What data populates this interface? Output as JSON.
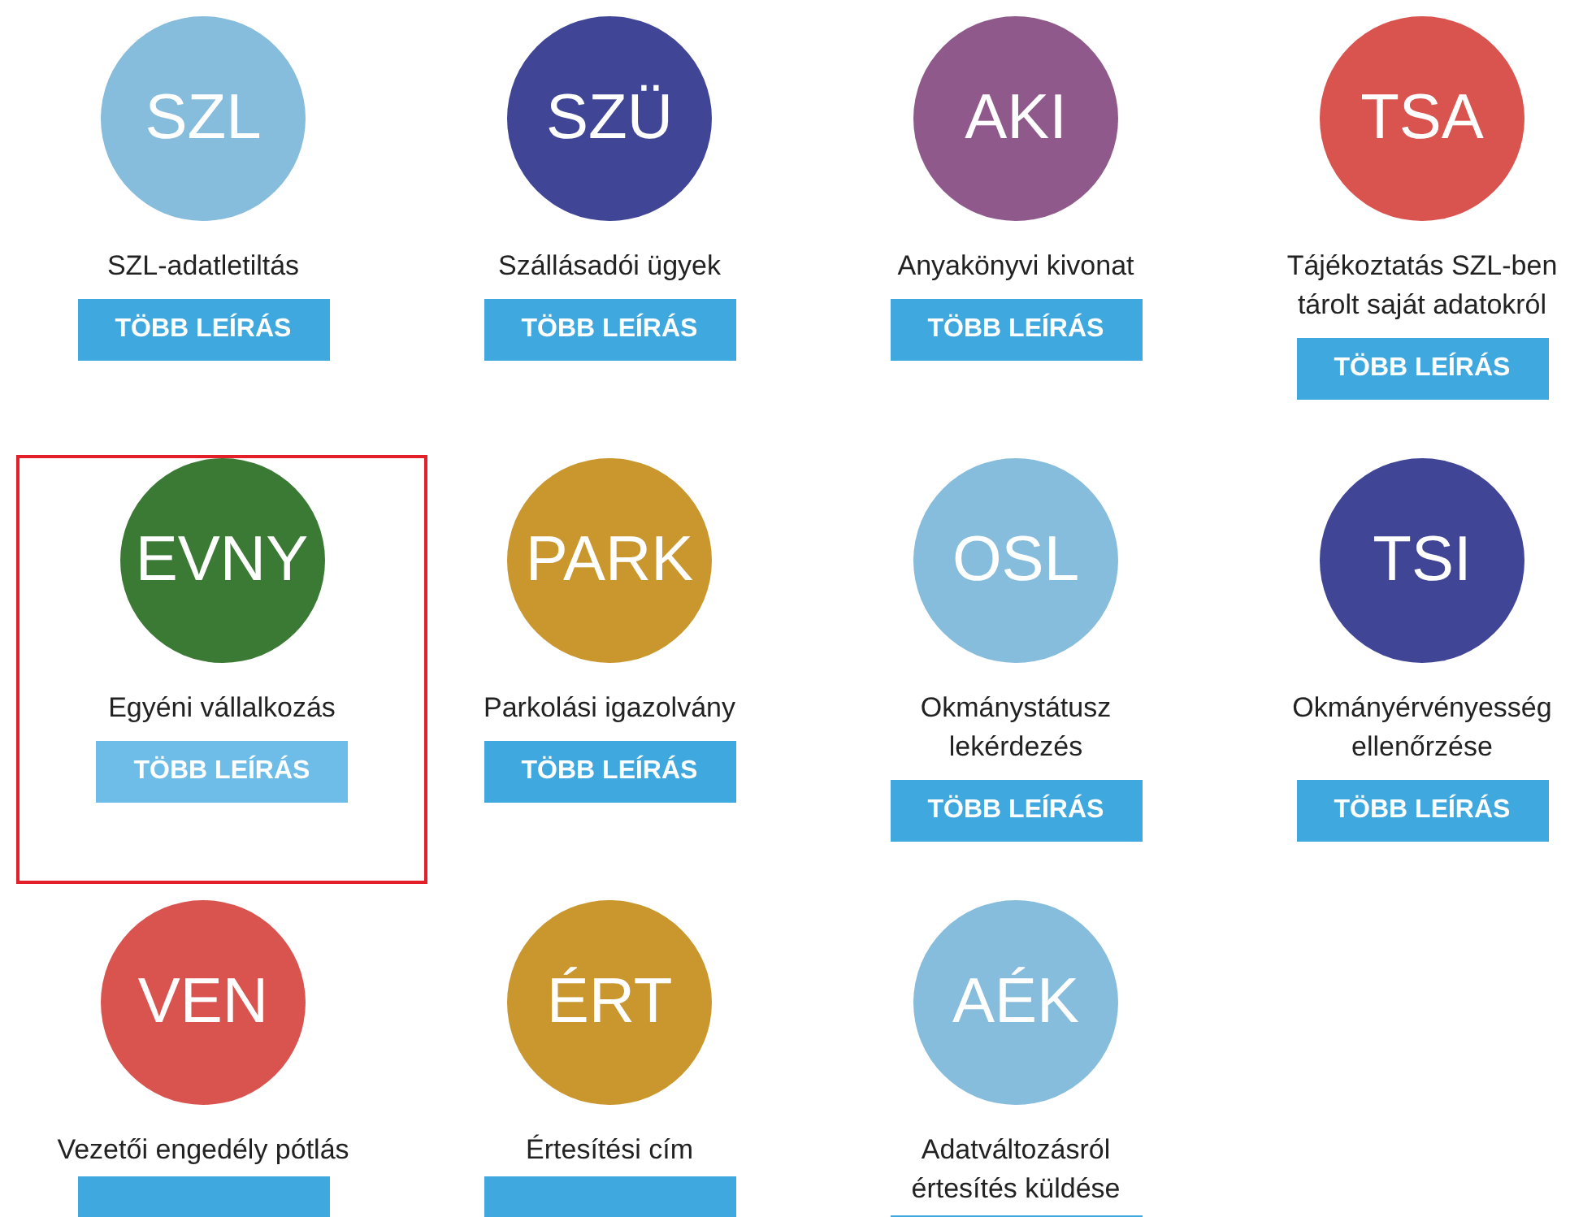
{
  "services": [
    {
      "abbr": "SZL",
      "color": "#86bcdc",
      "label": [
        "SZL-adatletiltás"
      ],
      "button": "TÖBB LEÍRÁS",
      "highlighted": false
    },
    {
      "abbr": "SZÜ",
      "color": "#404596",
      "label": [
        "Szállásadói ügyek"
      ],
      "button": "TÖBB LEÍRÁS",
      "highlighted": false
    },
    {
      "abbr": "AKI",
      "color": "#8f5a8b",
      "label": [
        "Anyakönyvi kivonat"
      ],
      "button": "TÖBB LEÍRÁS",
      "highlighted": false
    },
    {
      "abbr": "TSA",
      "color": "#d9534f",
      "label": [
        "Tájékoztatás SZL-ben",
        "tárolt saját adatokról"
      ],
      "button": "TÖBB LEÍRÁS",
      "highlighted": false
    },
    {
      "abbr": "EVNY",
      "color": "#3b7a34",
      "label": [
        "Egyéni vállalkozás"
      ],
      "button": "TÖBB LEÍRÁS",
      "highlighted": true
    },
    {
      "abbr": "PARK",
      "color": "#c9972e",
      "label": [
        "Parkolási igazolvány"
      ],
      "button": "TÖBB LEÍRÁS",
      "highlighted": false
    },
    {
      "abbr": "OSL",
      "color": "#86bcdc",
      "label": [
        "Okmánystátusz",
        "lekérdezés"
      ],
      "button": "TÖBB LEÍRÁS",
      "highlighted": false
    },
    {
      "abbr": "TSI",
      "color": "#404596",
      "label": [
        "Okmányérvényesség",
        "ellenőrzése"
      ],
      "button": "TÖBB LEÍRÁS",
      "highlighted": false
    },
    {
      "abbr": "VEN",
      "color": "#d9534f",
      "label": [
        "Vezetői engedély pótlás"
      ],
      "highlighted": false
    },
    {
      "abbr": "ÉRT",
      "color": "#c9972e",
      "label": [
        "Értesítési cím"
      ],
      "highlighted": false
    },
    {
      "abbr": "AÉK",
      "color": "#86bcdc",
      "label": [
        "Adatváltozásról",
        "értesítés küldése"
      ],
      "highlighted": false
    }
  ]
}
